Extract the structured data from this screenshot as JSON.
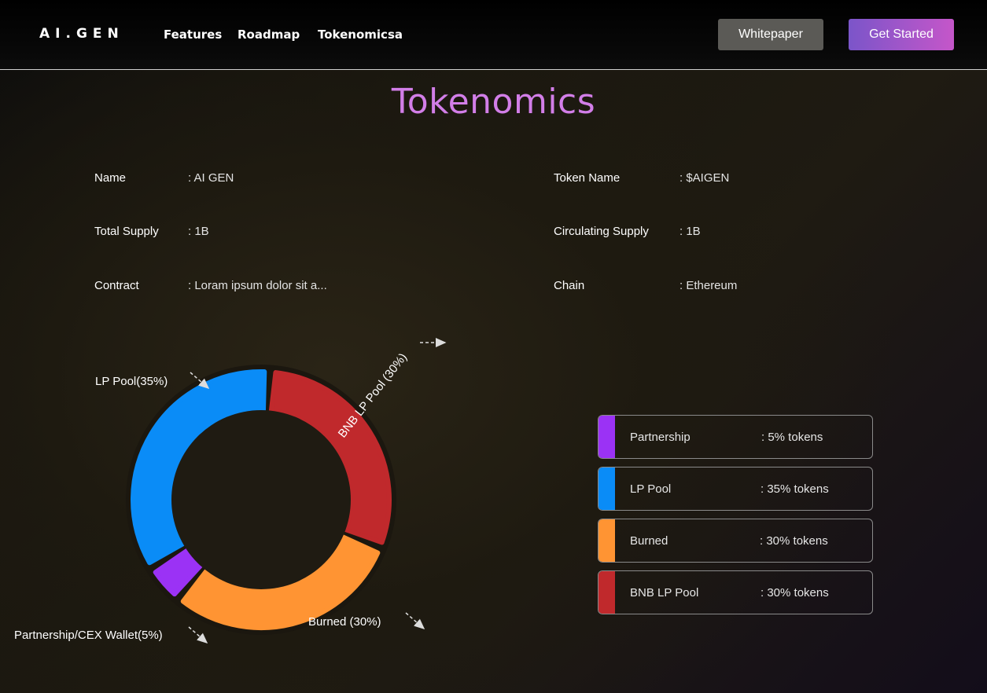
{
  "header": {
    "logo": "AI.GEN",
    "nav": [
      "Features",
      "Roadmap",
      "Tokenomicsa"
    ],
    "whitepaper_label": "Whitepaper",
    "get_started_label": "Get Started"
  },
  "page": {
    "title": "Tokenomics"
  },
  "info": {
    "left": [
      {
        "label": "Name",
        "value": ": AI GEN"
      },
      {
        "label": "Total Supply",
        "value": ": 1B"
      },
      {
        "label": "Contract",
        "value": ": Loram ipsum dolor sit a..."
      }
    ],
    "right": [
      {
        "label": "Token Name",
        "value": ": $AIGEN"
      },
      {
        "label": "Circulating Supply",
        "value": ": 1B"
      },
      {
        "label": "Chain",
        "value": ": Ethereum"
      }
    ]
  },
  "chart_data": {
    "type": "pie",
    "variant": "donut",
    "slices": [
      {
        "name": "BNB LP Pool",
        "value": 30,
        "color": "#c0292c",
        "label": "BNB LP Pool (30%)"
      },
      {
        "name": "Burned",
        "value": 30,
        "color": "#ff9433",
        "label": "Burned (30%)"
      },
      {
        "name": "Partnership",
        "value": 5,
        "color": "#9b32f5",
        "label": "Partnership/CEX Wallet(5%)"
      },
      {
        "name": "LP Pool",
        "value": 35,
        "color": "#0a8cf7",
        "label": "LP Pool(35%)"
      }
    ]
  },
  "legend": {
    "items": [
      {
        "name": "Partnership",
        "value": ": 5% tokens",
        "color": "#9b32f5"
      },
      {
        "name": "LP Pool",
        "value": ": 35% tokens",
        "color": "#0a8cf7"
      },
      {
        "name": "Burned",
        "value": ": 30% tokens",
        "color": "#ff9433"
      },
      {
        "name": "BNB LP Pool",
        "value": ": 30% tokens",
        "color": "#c0292c"
      }
    ]
  },
  "colors": {
    "title": "#d27ee8",
    "accent_gradient_start": "#7b55c9",
    "accent_gradient_end": "#c556c9"
  }
}
